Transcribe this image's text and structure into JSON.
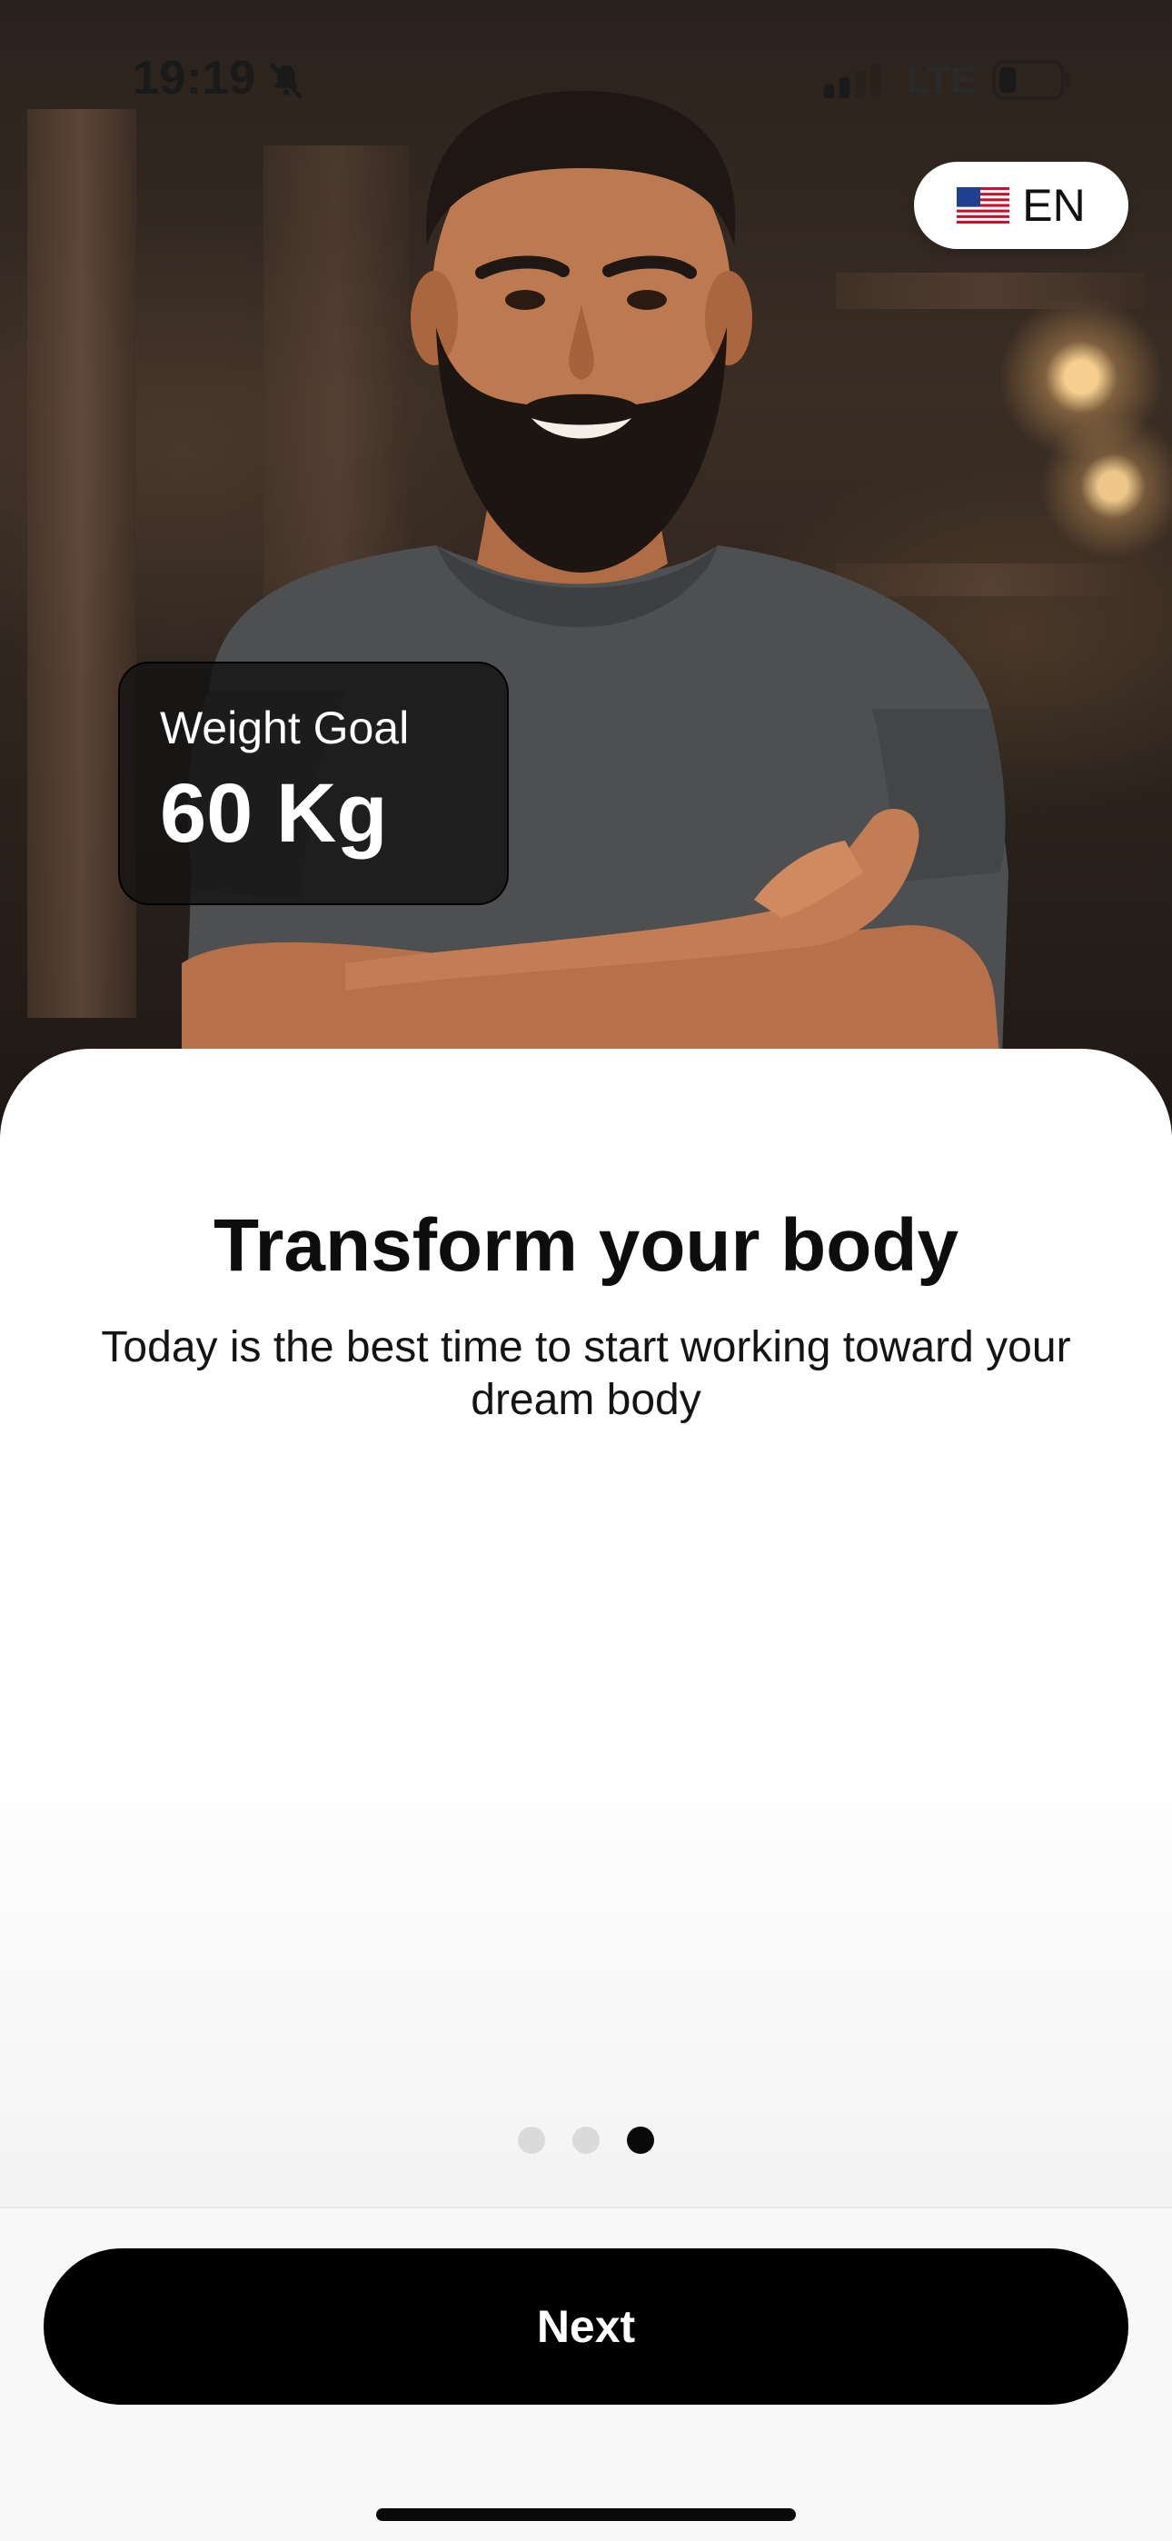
{
  "status_bar": {
    "time": "19:19",
    "network": "LTE",
    "icons": [
      "bell-slash-icon",
      "signal-icon",
      "battery-icon"
    ]
  },
  "language": {
    "flag": "us-flag-icon",
    "code": "EN"
  },
  "goal_card": {
    "label": "Weight Goal",
    "value": "60 Kg"
  },
  "onboarding": {
    "title": "Transform your body",
    "subtitle": "Today is the best time to start working toward your dream body",
    "page_count": 3,
    "current_page": 3
  },
  "footer": {
    "next_label": "Next"
  },
  "colors": {
    "primary": "#000000",
    "background": "#ffffff",
    "dot_inactive": "#dadada"
  }
}
